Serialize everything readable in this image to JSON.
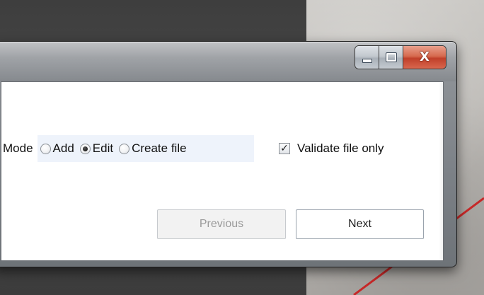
{
  "window": {
    "caption_buttons": {
      "minimize_icon": "minimize-icon",
      "maximize_icon": "maximize-icon",
      "close_icon": "close-icon",
      "close_glyph": "X"
    }
  },
  "form": {
    "mode_label": "Mode",
    "mode_options": [
      {
        "label": "Add",
        "selected": false
      },
      {
        "label": "Edit",
        "selected": true
      },
      {
        "label": "Create file",
        "selected": false
      }
    ],
    "validate_only": {
      "label": "Validate file only",
      "checked": true,
      "check_glyph": "✓"
    }
  },
  "buttons": {
    "previous": "Previous",
    "next": "Next"
  },
  "colors": {
    "close_button": "#c9442d",
    "mode_group_highlight": "#eef3fb",
    "desktop_accent_line": "#c62828"
  }
}
